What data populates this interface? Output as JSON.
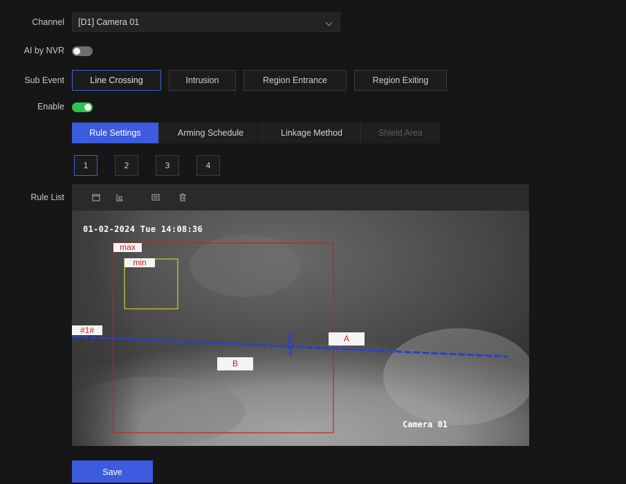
{
  "channel": {
    "label": "Channel",
    "value": "[D1] Camera 01"
  },
  "ai_by_nvr": {
    "label": "AI by NVR",
    "state": "off"
  },
  "sub_event": {
    "label": "Sub Event",
    "options": [
      "Line Crossing",
      "Intrusion",
      "Region Entrance",
      "Region Exiting"
    ],
    "selected": "Line Crossing"
  },
  "enable": {
    "label": "Enable",
    "state": "on"
  },
  "tabs": [
    "Rule Settings",
    "Arming Schedule",
    "Linkage Method",
    "Shield Area"
  ],
  "active_tab": "Rule Settings",
  "disabled_tab": "Shield Area",
  "rules": [
    "1",
    "2",
    "3",
    "4"
  ],
  "selected_rule": "1",
  "rule_list": {
    "label": "Rule List",
    "toolbar_icons": [
      "draw-rectangle-icon",
      "draw-area-icon",
      "fullscreen-icon",
      "delete-icon"
    ]
  },
  "video": {
    "timestamp": "01-02-2024 Tue 14:08:36",
    "camera_name": "Camera 01",
    "overlay_labels": {
      "max": "max",
      "min": "min",
      "line_id": "#1#",
      "side_a": "A",
      "side_b": "B"
    },
    "colors": {
      "max_box": "#c8201e",
      "min_box": "#d6cc2a",
      "line": "#2a3fd0"
    }
  },
  "save_label": "Save",
  "colors": {
    "accent": "#3c5bde",
    "toggle_on": "#2fc24d"
  }
}
